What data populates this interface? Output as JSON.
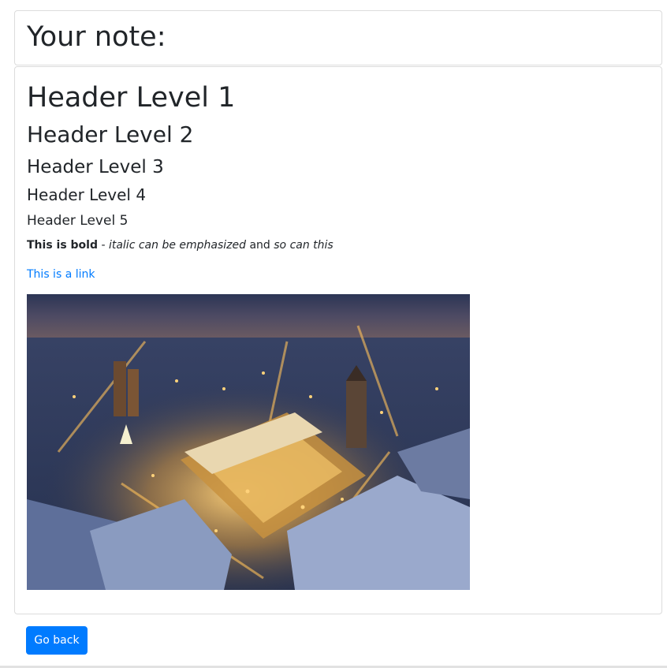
{
  "header": {
    "title": "Your note:"
  },
  "note": {
    "h1": "Header Level 1",
    "h2": "Header Level 2",
    "h3": "Header Level 3",
    "h4": "Header Level 4",
    "h5": "Header Level 5",
    "bold": "This is bold",
    "sep": " - ",
    "italic": "italic can be emphasized",
    "middle": " and ",
    "italic2": "so can this",
    "link": "This is a link"
  },
  "actions": {
    "back": "Go back"
  }
}
